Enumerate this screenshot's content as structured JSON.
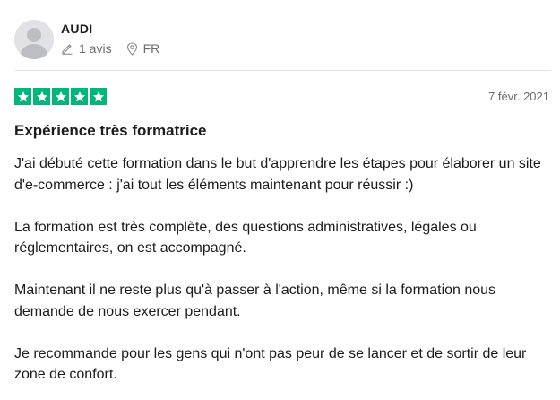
{
  "reviewer": {
    "name": "AUDI",
    "reviews_count": "1 avis",
    "country": "FR"
  },
  "review": {
    "rating": 5,
    "rating_color": "#00b67a",
    "date": "7 févr. 2021",
    "title": "Expérience très formatrice",
    "paragraphs": [
      "J'ai débuté cette formation dans le but d'apprendre les étapes pour élaborer un site d'e-commerce : j'ai tout les éléments maintenant pour réussir :)",
      "La formation est très complète, des questions administratives, légales ou réglementaires, on est accompagné.",
      "Maintenant il ne reste plus qu'à passer à l'action, même si la formation nous demande de nous exercer pendant.",
      "Je recommande pour les gens qui n'ont pas peur de se lancer et de sortir de leur zone de confort."
    ]
  },
  "icons": {
    "avatar": "default-user-avatar",
    "reviews": "pencil-icon",
    "country": "location-pin-icon",
    "star": "star-icon"
  }
}
